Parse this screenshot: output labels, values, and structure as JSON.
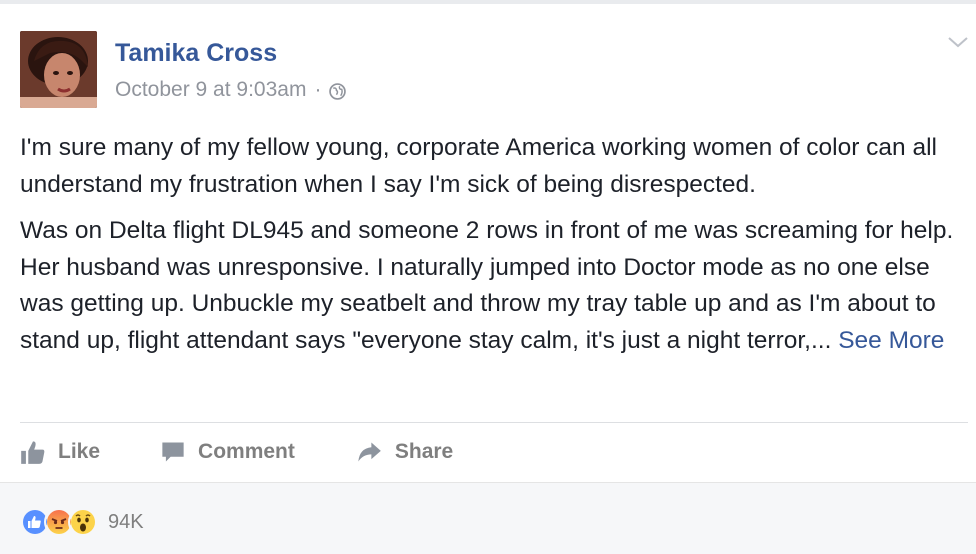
{
  "post": {
    "author": "Tamika Cross",
    "timestamp": "October 9 at 9:03am",
    "separator": "·",
    "paragraph1": "I'm sure many of my fellow young, corporate America working women of color can all understand my frustration when I say I'm sick of being disrespected.",
    "paragraph2": "Was on Delta flight DL945 and someone 2 rows in front of me was screaming for help. Her husband was unresponsive. I naturally jumped into Doctor mode as no one else was getting up. Unbuckle my seatbelt and throw my tray table up and as I'm about to stand up, flight attendant says \"everyone stay calm, it's just a night terror,...",
    "see_more": "See More"
  },
  "actions": {
    "like": "Like",
    "comment": "Comment",
    "share": "Share"
  },
  "reactions": {
    "count": "94K",
    "types": [
      "like-icon",
      "angry-icon",
      "wow-icon"
    ]
  },
  "colors": {
    "link": "#365899",
    "muted": "#90949c",
    "like_blue": "#5890ff",
    "angry_orange": "#f7714c",
    "wow_yellow": "#fcd34a"
  }
}
